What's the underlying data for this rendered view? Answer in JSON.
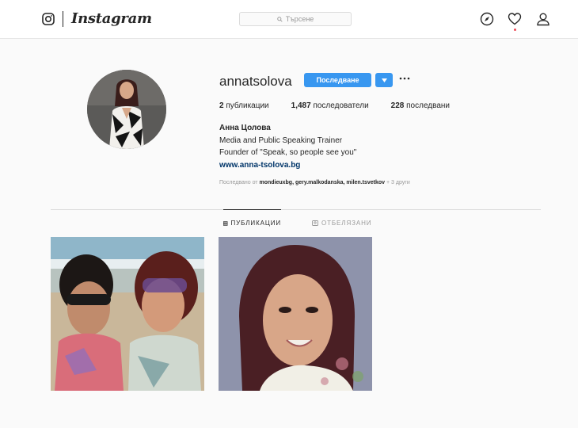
{
  "header": {
    "logo_text": "Instagram",
    "search_placeholder": "Търсене",
    "icons": [
      "compass-icon",
      "heart-icon",
      "profile-icon"
    ]
  },
  "profile": {
    "username": "annatsolova",
    "follow_label": "Последване",
    "stats": [
      {
        "value": "2",
        "label": "публикации"
      },
      {
        "value": "1,487",
        "label": "последователи"
      },
      {
        "value": "228",
        "label": "последвани"
      }
    ],
    "full_name": "Анна Цолова",
    "bio_line1": "Media and Public Speaking Trainer",
    "bio_line2": "Founder of \"Speak, so people see you\"",
    "website": "www.anna-tsolova.bg",
    "followed_by_prefix": "Последвано от",
    "followed_by_users": "mondieuxbg, gery.malkodanska, milen.tsvetkov",
    "followed_by_suffix": "+ 3 други"
  },
  "tabs": [
    {
      "label": "ПУБЛИКАЦИИ",
      "active": true
    },
    {
      "label": "ОТБЕЛЯЗАНИ",
      "active": false
    }
  ],
  "colors": {
    "accent": "#3897f0",
    "notification": "#ed4956",
    "link": "#003569"
  }
}
